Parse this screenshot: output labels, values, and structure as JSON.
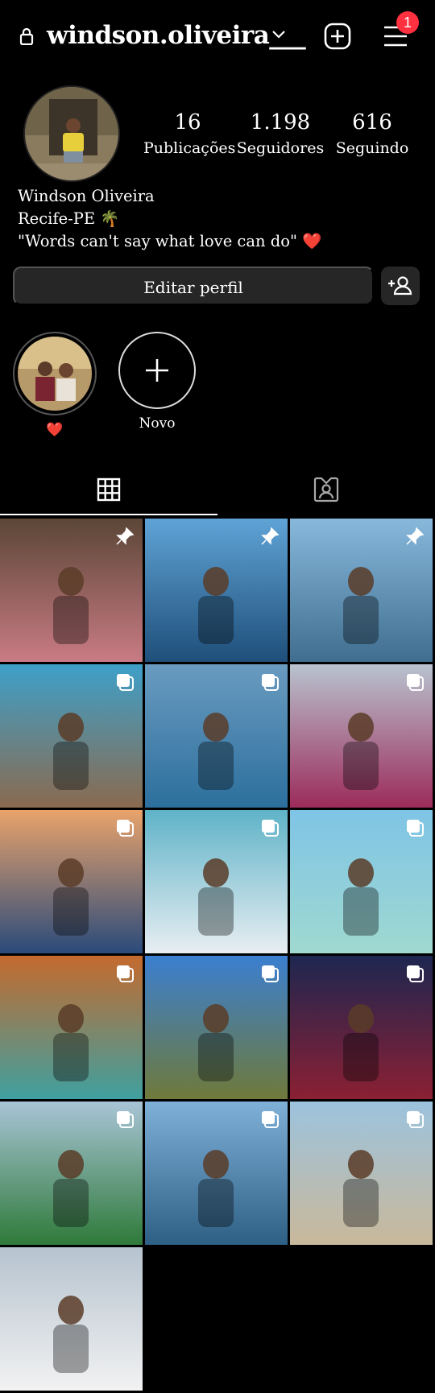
{
  "header": {
    "username": "windson.oliveira___",
    "notifications_count": "1",
    "icons": {
      "lock": "lock-icon",
      "chevron": "chevron-down-icon",
      "new_post": "plus-square-icon",
      "menu": "hamburger-menu-icon"
    }
  },
  "profile": {
    "stats": [
      {
        "value": "16",
        "label": "Publicações"
      },
      {
        "value": "1.198",
        "label": "Seguidores"
      },
      {
        "value": "616",
        "label": "Seguindo"
      }
    ],
    "bio": {
      "name": "Windson Oliveira",
      "location": "Recife-PE 🌴",
      "quote": "\"Words can't say what love can do\" ❤️"
    },
    "edit_button": "Editar perfil",
    "discover_people_icon": "add-person-icon"
  },
  "highlights": [
    {
      "label": "❤️"
    },
    {
      "label": "Novo"
    }
  ],
  "tabs": [
    {
      "name": "posts-grid",
      "icon": "grid-icon",
      "active": true
    },
    {
      "name": "tagged",
      "icon": "tagged-person-icon",
      "active": false
    }
  ],
  "posts": [
    {
      "desc": "selfie",
      "icon": "pin",
      "c1": "#5b4636",
      "c2": "#c97b84"
    },
    {
      "desc": "sea",
      "icon": "pin",
      "c1": "#5fa3d6",
      "c2": "#1f4f7a"
    },
    {
      "desc": "city-shore",
      "icon": "pin",
      "c1": "#88b8dc",
      "c2": "#3f6e8f"
    },
    {
      "desc": "pool",
      "icon": "multi",
      "c1": "#3ea0c9",
      "c2": "#8a6a4f"
    },
    {
      "desc": "kiss",
      "icon": "multi",
      "c1": "#6a9bc0",
      "c2": "#2c6f9d"
    },
    {
      "desc": "flowers",
      "icon": "multi",
      "c1": "#b8c3cf",
      "c2": "#9c2b5b"
    },
    {
      "desc": "sunset",
      "icon": "multi",
      "c1": "#e9a36b",
      "c2": "#2a4a7a"
    },
    {
      "desc": "boat",
      "icon": "multi",
      "c1": "#5fb3c8",
      "c2": "#e8eef2"
    },
    {
      "desc": "beach",
      "icon": "multi",
      "c1": "#7fc4e6",
      "c2": "#9fd9d0"
    },
    {
      "desc": "store",
      "icon": "multi",
      "c1": "#c46a2e",
      "c2": "#3fa0a0"
    },
    {
      "desc": "clouds",
      "icon": "multi",
      "c1": "#3b7fd0",
      "c2": "#6f7a3a"
    },
    {
      "desc": "night",
      "icon": "multi",
      "c1": "#1d2650",
      "c2": "#8b2033"
    },
    {
      "desc": "group",
      "icon": "multi",
      "c1": "#a8c4d6",
      "c2": "#2f7a3a"
    },
    {
      "desc": "pier",
      "icon": "multi",
      "c1": "#7fb0d8",
      "c2": "#2e5f84"
    },
    {
      "desc": "shore",
      "icon": "multi",
      "c1": "#9cc3de",
      "c2": "#c9b89a"
    },
    {
      "desc": "selfie-hat",
      "icon": "none",
      "c1": "#b6c3cf",
      "c2": "#f2f2f2"
    }
  ]
}
